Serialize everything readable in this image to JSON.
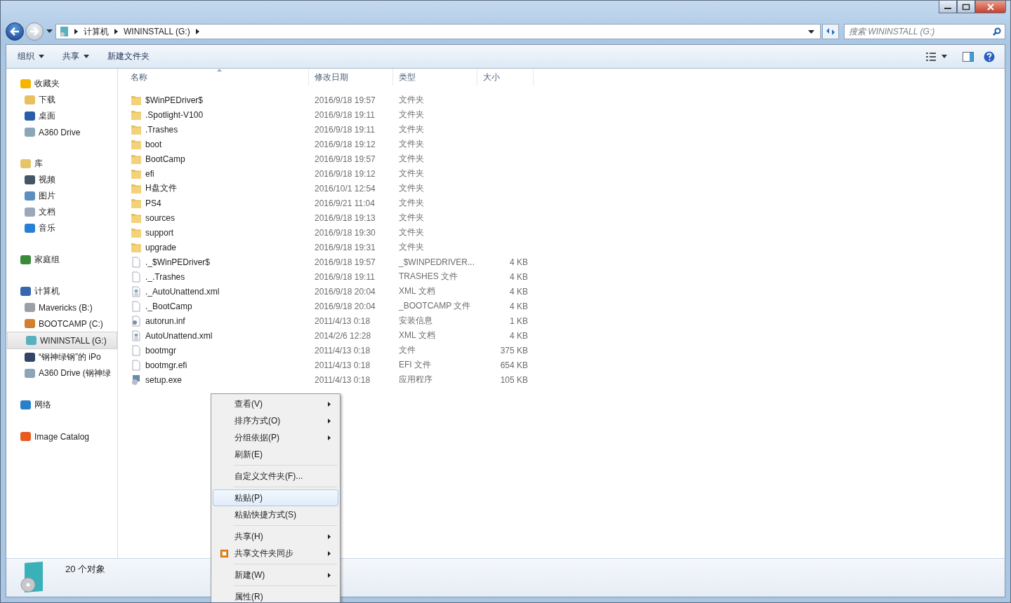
{
  "address": {
    "crumbs": [
      "计算机",
      "WININSTALL (G:)"
    ]
  },
  "search": {
    "placeholder": "搜索 WININSTALL (G:)"
  },
  "toolbar": [
    {
      "label": "组织",
      "dropdown": true
    },
    {
      "label": "共享",
      "dropdown": true
    },
    {
      "label": "新建文件夹",
      "dropdown": false
    }
  ],
  "sidebar": {
    "sections": [
      {
        "label": "收藏夹",
        "kind": "star",
        "children": [
          {
            "label": "下载",
            "kind": "download",
            "selected": false
          },
          {
            "label": "桌面",
            "kind": "desktop",
            "selected": false
          },
          {
            "label": "A360 Drive",
            "kind": "cloud",
            "selected": false
          }
        ]
      },
      {
        "label": "库",
        "kind": "library",
        "children": [
          {
            "label": "视频",
            "kind": "video",
            "selected": false
          },
          {
            "label": "图片",
            "kind": "picture",
            "selected": false
          },
          {
            "label": "文档",
            "kind": "document",
            "selected": false
          },
          {
            "label": "音乐",
            "kind": "music",
            "selected": false
          }
        ]
      },
      {
        "label": "家庭组",
        "kind": "homegroup"
      },
      {
        "label": "计算机",
        "kind": "computer",
        "children": [
          {
            "label": "Mavericks (B:)",
            "kind": "drive",
            "selected": false
          },
          {
            "label": "BOOTCAMP (C:)",
            "kind": "windrive",
            "selected": false
          },
          {
            "label": "WININSTALL (G:)",
            "kind": "installdrive",
            "selected": true
          },
          {
            "label": "“钢神绿钢”的 iPo",
            "kind": "device",
            "selected": false
          },
          {
            "label": "A360 Drive (钢神绿",
            "kind": "cloud",
            "selected": false
          }
        ]
      },
      {
        "label": "网络",
        "kind": "network"
      },
      {
        "label": "Image Catalog",
        "kind": "catalog"
      }
    ]
  },
  "table": {
    "columns": [
      {
        "label": "名称",
        "sorted": true
      },
      {
        "label": "修改日期",
        "sorted": false
      },
      {
        "label": "类型",
        "sorted": false
      },
      {
        "label": "大小",
        "sorted": false
      }
    ],
    "rows": [
      {
        "name": "$WinPEDriver$",
        "date": "2016/9/18 19:57",
        "type": "文件夹",
        "kind": "folder"
      },
      {
        "name": ".Spotlight-V100",
        "date": "2016/9/18 19:11",
        "type": "文件夹",
        "kind": "folder"
      },
      {
        "name": ".Trashes",
        "date": "2016/9/18 19:11",
        "type": "文件夹",
        "kind": "folder"
      },
      {
        "name": "boot",
        "date": "2016/9/18 19:12",
        "type": "文件夹",
        "kind": "folder"
      },
      {
        "name": "BootCamp",
        "date": "2016/9/18 19:57",
        "type": "文件夹",
        "kind": "folder"
      },
      {
        "name": "efi",
        "date": "2016/9/18 19:12",
        "type": "文件夹",
        "kind": "folder"
      },
      {
        "name": "H盘文件",
        "date": "2016/10/1 12:54",
        "type": "文件夹",
        "kind": "folder"
      },
      {
        "name": "PS4",
        "date": "2016/9/21 11:04",
        "type": "文件夹",
        "kind": "folder"
      },
      {
        "name": "sources",
        "date": "2016/9/18 19:13",
        "type": "文件夹",
        "kind": "folder"
      },
      {
        "name": "support",
        "date": "2016/9/18 19:30",
        "type": "文件夹",
        "kind": "folder"
      },
      {
        "name": "upgrade",
        "date": "2016/9/18 19:31",
        "type": "文件夹",
        "kind": "folder"
      },
      {
        "name": "._$WinPEDriver$",
        "date": "2016/9/18 19:57",
        "type": "_$WINPEDRIVER...",
        "size": "4 KB",
        "kind": "file"
      },
      {
        "name": "._.Trashes",
        "date": "2016/9/18 19:11",
        "type": "TRASHES 文件",
        "size": "4 KB",
        "kind": "file"
      },
      {
        "name": "._AutoUnattend.xml",
        "date": "2016/9/18 20:04",
        "type": "XML 文档",
        "size": "4 KB",
        "kind": "xml"
      },
      {
        "name": "._BootCamp",
        "date": "2016/9/18 20:04",
        "type": "_BOOTCAMP 文件",
        "size": "4 KB",
        "kind": "file"
      },
      {
        "name": "autorun.inf",
        "date": "2011/4/13 0:18",
        "type": "安装信息",
        "size": "1 KB",
        "kind": "setting"
      },
      {
        "name": "AutoUnattend.xml",
        "date": "2014/2/6 12:28",
        "type": "XML 文档",
        "size": "4 KB",
        "kind": "xml"
      },
      {
        "name": "bootmgr",
        "date": "2011/4/13 0:18",
        "type": "文件",
        "size": "375 KB",
        "kind": "file"
      },
      {
        "name": "bootmgr.efi",
        "date": "2011/4/13 0:18",
        "type": "EFI 文件",
        "size": "654 KB",
        "kind": "file"
      },
      {
        "name": "setup.exe",
        "date": "2011/4/13 0:18",
        "type": "应用程序",
        "size": "105 KB",
        "kind": "app"
      }
    ]
  },
  "context_menu": {
    "groups": [
      [
        {
          "label": "查看(V)",
          "submenu": true,
          "selected": false
        },
        {
          "label": "排序方式(O)",
          "submenu": true,
          "selected": false
        },
        {
          "label": "分组依据(P)",
          "submenu": true,
          "selected": false
        },
        {
          "label": "刷新(E)",
          "submenu": false,
          "selected": false
        }
      ],
      [
        {
          "label": "自定义文件夹(F)...",
          "submenu": false,
          "selected": false
        }
      ],
      [
        {
          "label": "粘贴(P)",
          "submenu": false,
          "selected": true
        },
        {
          "label": "粘贴快捷方式(S)",
          "submenu": false,
          "selected": false
        }
      ],
      [
        {
          "label": "共享(H)",
          "submenu": true,
          "selected": false
        },
        {
          "label": "共享文件夹同步",
          "submenu": true,
          "selected": false,
          "icon": true
        }
      ],
      [
        {
          "label": "新建(W)",
          "submenu": true,
          "selected": false
        }
      ],
      [
        {
          "label": "属性(R)",
          "submenu": false,
          "selected": false
        }
      ]
    ]
  },
  "status_bar": {
    "text": "20 个对象"
  }
}
